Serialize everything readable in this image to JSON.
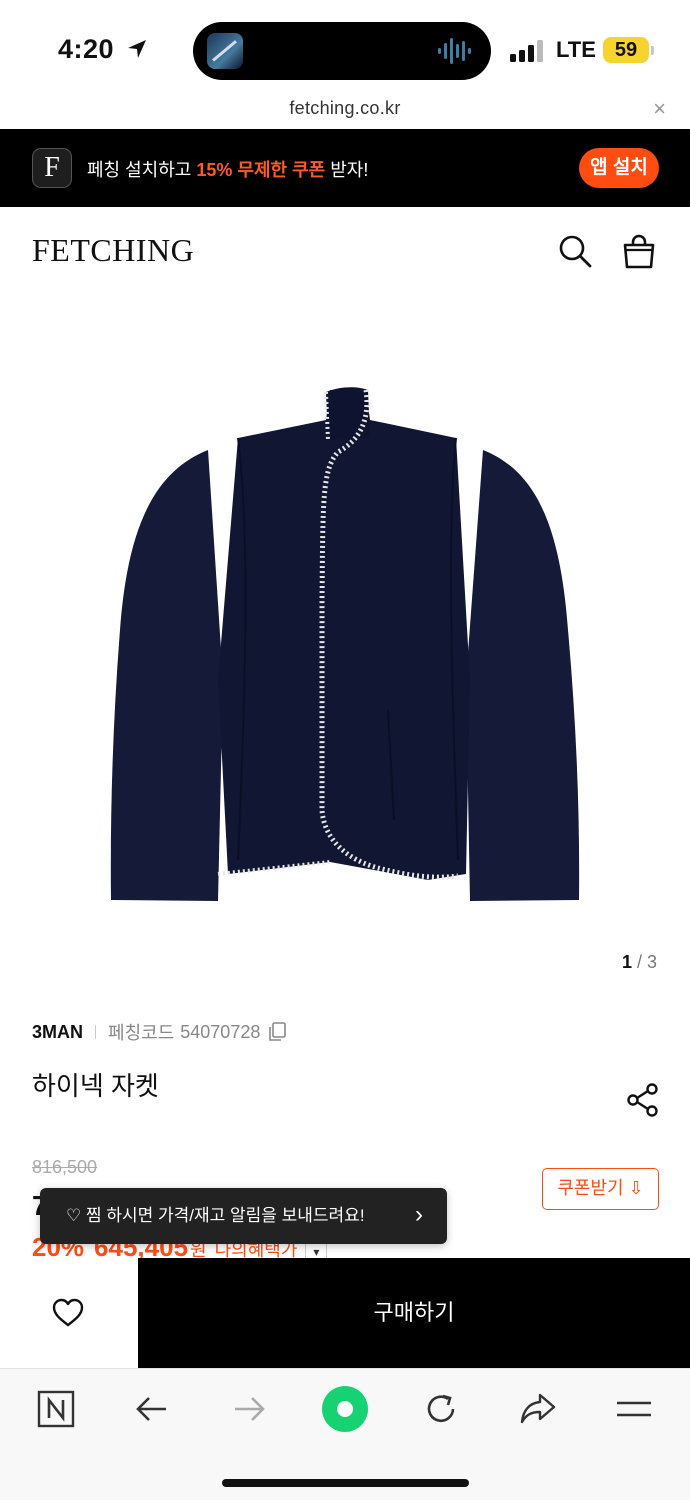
{
  "status_bar": {
    "time": "4:20",
    "network": "LTE",
    "battery": "59"
  },
  "browser": {
    "url": "fetching.co.kr",
    "close_glyph": "×"
  },
  "app_banner": {
    "logo_letter": "F",
    "text_before": "페칭 설치하고 ",
    "text_highlight": "15% 무제한 쿠폰",
    "text_after": " 받자!",
    "install_label": "앱 설치"
  },
  "header": {
    "logo": "FETCHING",
    "search_icon": "search-icon",
    "bag_icon": "shopping-bag-icon"
  },
  "gallery": {
    "current": "1",
    "separator": " / ",
    "total": "3"
  },
  "product": {
    "brand": "3MAN",
    "code_label": "페칭코드",
    "code_value": "54070728",
    "name": "하이넥 자켓",
    "original_price": "816,500",
    "price_prefix": "7",
    "discount_percent": "20%",
    "discount_price": "645,405",
    "discount_unit": "원",
    "my_benefit_label": "나의혜택가",
    "coupon_label": "쿠폰받기 ⇩"
  },
  "toast": {
    "message": "♡ 찜 하시면 가격/재고 알림을 보내드려요!",
    "chevron": "›"
  },
  "purchase": {
    "buy_label": "구매하기"
  },
  "colors": {
    "accent": "#ff4d12",
    "jacket": "#141a38",
    "stitch": "#e6e6e6"
  }
}
